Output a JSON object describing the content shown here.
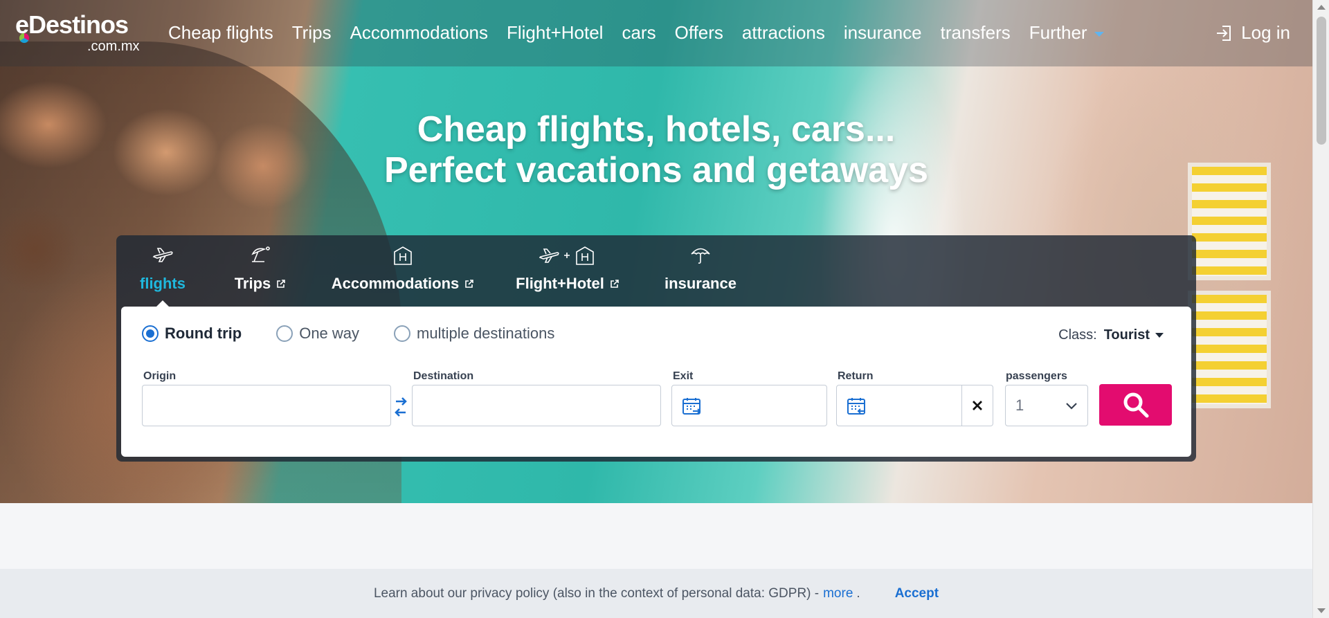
{
  "brand": {
    "name": "eDestinos",
    "domain": ".com.mx",
    "accent": "#e30c6f",
    "link_color": "#1a6fd2",
    "active_tab_color": "#1fb8dd"
  },
  "topnav": {
    "items": [
      "Cheap flights",
      "Trips",
      "Accommodations",
      "Flight+Hotel",
      "cars",
      "Offers",
      "attractions",
      "insurance",
      "transfers",
      "Further"
    ],
    "login_label": "Log in",
    "login_icon": "login-icon"
  },
  "hero": {
    "line1": "Cheap flights, hotels, cars...",
    "line2": "Perfect vacations and getaways"
  },
  "search": {
    "tabs": [
      {
        "label": "flights",
        "icon": "plane-icon",
        "active": true,
        "external": false
      },
      {
        "label": "Trips",
        "icon": "beach-umbrella-icon",
        "active": false,
        "external": true
      },
      {
        "label": "Accommodations",
        "icon": "hotel-icon",
        "active": false,
        "external": true
      },
      {
        "label": "Flight+Hotel",
        "icon": "plane-plus-hotel-icon",
        "active": false,
        "external": true
      },
      {
        "label": "insurance",
        "icon": "umbrella-icon",
        "active": false,
        "external": false
      }
    ],
    "trip_types": [
      {
        "label": "Round trip",
        "checked": true
      },
      {
        "label": "One way",
        "checked": false
      },
      {
        "label": "multiple destinations",
        "checked": false
      }
    ],
    "class_label": "Class:",
    "class_value": "Tourist",
    "fields": {
      "origin_label": "Origin",
      "origin_value": "",
      "destination_label": "Destination",
      "destination_value": "",
      "exit_label": "Exit",
      "exit_value": "",
      "return_label": "Return",
      "return_value": "",
      "passengers_label": "passengers",
      "passengers_value": "1"
    }
  },
  "cookie_bar": {
    "text": "Learn about our privacy policy (also in the context of personal data: GDPR) -",
    "more_label": "more",
    "after_more": ".",
    "accept_label": "Accept"
  }
}
